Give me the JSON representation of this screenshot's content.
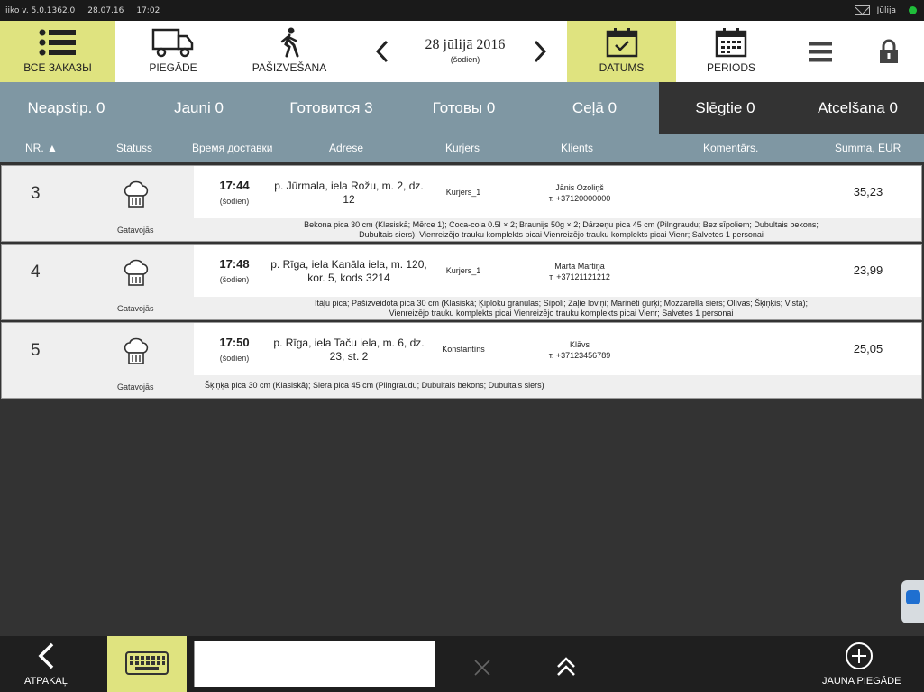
{
  "status_bar": {
    "app_version": "iiko v. 5.0.1362.0",
    "date": "28.07.16",
    "time": "17:02",
    "user": "Jūlija",
    "online_color": "#1fbe3a"
  },
  "toolbar": {
    "all_orders": "ВСЕ ЗАКАЗЫ",
    "delivery": "PIEGĀDE",
    "pickup": "PAŠIZVEŠANA",
    "date_main": "28 jūlijā 2016",
    "date_sub": "(šodien)",
    "datums": "DATUMS",
    "periods": "PERIODS",
    "active_color": "#dfe37f"
  },
  "tabs": [
    {
      "label": "Neapstip. 0"
    },
    {
      "label": "Jauni 0"
    },
    {
      "label": "Готовится 3"
    },
    {
      "label": "Готовы 0"
    },
    {
      "label": "Ceļā 0"
    },
    {
      "label": "Slēgtie 0"
    },
    {
      "label": "Atcelšana 0"
    }
  ],
  "columns": {
    "nr": "NR.",
    "status": "Statuss",
    "delivery_time": "Время доставки",
    "address": "Adrese",
    "courier": "Kurjers",
    "client": "Klients",
    "comment": "Komentārs.",
    "sum": "Summa, EUR"
  },
  "orders": [
    {
      "nr": "3",
      "status": "Gatavojās",
      "time": "17:44",
      "day": "(šodien)",
      "address": "p. Jūrmala, iela Rožu, m. 2, dz. 12",
      "courier": "Kurjers_1",
      "client_name": "Jānis Ozoliņš",
      "client_phone": "т. +37120000000",
      "comment": "",
      "sum": "35,23",
      "items_line1": "Bekona pica 30 cm (Klasiskā; Mērce 1); Coca-cola 0.5l × 2; Braunijs 50g × 2; Dārzeņu pica 45 cm (Pilngraudu; Bez sīpoliem; Dubultais bekons;",
      "items_line2": "Dubultais siers); Vienreizējo trauku komplekts picai Vienreizējo trauku komplekts picai Vienr; Salvetes 1 personai"
    },
    {
      "nr": "4",
      "status": "Gatavojās",
      "time": "17:48",
      "day": "(šodien)",
      "address": "p. Rīga, iela Kanāla iela, m. 120, kor. 5, kods 3214",
      "courier": "Kurjers_1",
      "client_name": "Marta Martiņa",
      "client_phone": "т. +37121121212",
      "comment": "",
      "sum": "23,99",
      "items_line1": "Itāļu pica; Pašizveidota pica 30 cm (Klasiskā; Ķiploku granulas; Sīpoli; Zaļie loviņi; Marinēti gurķi; Mozzarella siers; Olīvas; Šķiņķis; Vista);",
      "items_line2": "Vienreizējo trauku komplekts picai Vienreizējo trauku komplekts picai Vienr; Salvetes 1 personai"
    },
    {
      "nr": "5",
      "status": "Gatavojās",
      "time": "17:50",
      "day": "(šodien)",
      "address": "p. Rīga, iela Taču iela, m. 6, dz. 23, st. 2",
      "courier": "Konstantīns",
      "client_name": "Klāvs",
      "client_phone": "т. +37123456789",
      "comment": "",
      "sum": "25,05",
      "items_line1": "Šķiņķa pica 30 cm (Klasiskā); Siera pica 45 cm (Pilngraudu; Dubultais bekons; Dubultais siers)",
      "items_line2": ""
    }
  ],
  "bottom": {
    "back": "ATPAKAĻ",
    "search_value": "",
    "new_delivery": "JAUNA PIEGĀDE"
  }
}
